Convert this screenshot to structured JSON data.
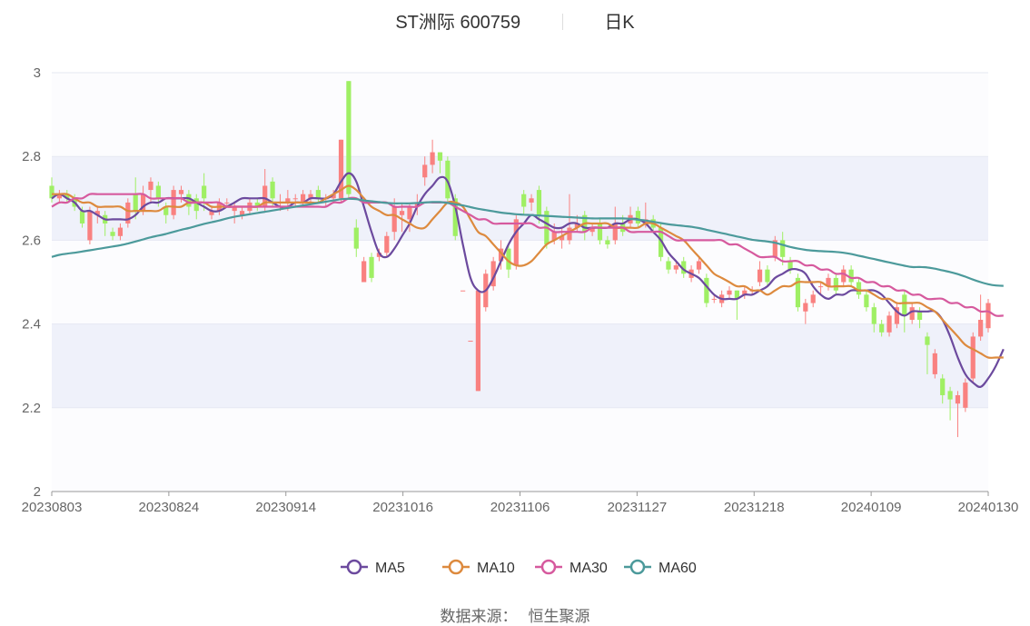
{
  "header": {
    "stock": "ST洲际 600759",
    "period": "日K"
  },
  "source": {
    "label": "数据来源：",
    "value": "恒生聚源"
  },
  "chart_data": {
    "type": "candlestick",
    "ylim": [
      2,
      3
    ],
    "y_ticks": [
      "2",
      "2.2",
      "2.4",
      "2.6",
      "2.8",
      "3"
    ],
    "x_ticks": [
      "20230803",
      "20230824",
      "20230914",
      "20231016",
      "20231106",
      "20231127",
      "20231218",
      "20240109",
      "20240130"
    ],
    "colors": {
      "up": "#f98180",
      "down": "#9fef64",
      "band": "#eff1fa",
      "grid": "#e6e8f2",
      "axis": "#999999"
    },
    "candles": [
      [
        2.73,
        2.7,
        2.75,
        2.69
      ],
      [
        2.7,
        2.71,
        2.72,
        2.69
      ],
      [
        2.71,
        2.7,
        2.72,
        2.69
      ],
      [
        2.7,
        2.68,
        2.71,
        2.67
      ],
      [
        2.67,
        2.64,
        2.68,
        2.63
      ],
      [
        2.6,
        2.67,
        2.68,
        2.59
      ],
      [
        2.66,
        2.67,
        2.68,
        2.64
      ],
      [
        2.66,
        2.64,
        2.67,
        2.61
      ],
      [
        2.62,
        2.61,
        2.63,
        2.6
      ],
      [
        2.61,
        2.63,
        2.64,
        2.6
      ],
      [
        2.64,
        2.69,
        2.7,
        2.63
      ],
      [
        2.71,
        2.67,
        2.75,
        2.65
      ],
      [
        2.67,
        2.71,
        2.73,
        2.66
      ],
      [
        2.72,
        2.74,
        2.75,
        2.69
      ],
      [
        2.73,
        2.7,
        2.74,
        2.68
      ],
      [
        2.68,
        2.66,
        2.69,
        2.64
      ],
      [
        2.66,
        2.72,
        2.73,
        2.65
      ],
      [
        2.71,
        2.72,
        2.73,
        2.69
      ],
      [
        2.71,
        2.68,
        2.72,
        2.66
      ],
      [
        2.7,
        2.67,
        2.71,
        2.65
      ],
      [
        2.73,
        2.7,
        2.76,
        2.67
      ],
      [
        2.66,
        2.67,
        2.68,
        2.65
      ],
      [
        2.67,
        2.69,
        2.7,
        2.66
      ],
      [
        2.69,
        2.69,
        2.7,
        2.68
      ],
      [
        2.67,
        2.68,
        2.69,
        2.64
      ],
      [
        2.66,
        2.67,
        2.68,
        2.65
      ],
      [
        2.67,
        2.69,
        2.7,
        2.66
      ],
      [
        2.69,
        2.68,
        2.7,
        2.67
      ],
      [
        2.68,
        2.73,
        2.77,
        2.67
      ],
      [
        2.74,
        2.7,
        2.75,
        2.68
      ],
      [
        2.69,
        2.69,
        2.71,
        2.67
      ],
      [
        2.69,
        2.7,
        2.72,
        2.67
      ],
      [
        2.7,
        2.7,
        2.71,
        2.68
      ],
      [
        2.69,
        2.71,
        2.72,
        2.68
      ],
      [
        2.7,
        2.71,
        2.72,
        2.69
      ],
      [
        2.72,
        2.7,
        2.73,
        2.69
      ],
      [
        2.7,
        2.7,
        2.71,
        2.68
      ],
      [
        2.7,
        2.71,
        2.72,
        2.69
      ],
      [
        2.7,
        2.84,
        2.84,
        2.69
      ],
      [
        2.98,
        2.71,
        2.98,
        2.7
      ],
      [
        2.63,
        2.58,
        2.65,
        2.56
      ],
      [
        2.5,
        2.55,
        2.56,
        2.5
      ],
      [
        2.56,
        2.51,
        2.57,
        2.5
      ],
      [
        2.56,
        2.57,
        2.58,
        2.55
      ],
      [
        2.57,
        2.61,
        2.62,
        2.56
      ],
      [
        2.62,
        2.68,
        2.7,
        2.6
      ],
      [
        2.66,
        2.67,
        2.69,
        2.62
      ],
      [
        2.65,
        2.68,
        2.69,
        2.62
      ],
      [
        2.68,
        2.69,
        2.71,
        2.66
      ],
      [
        2.75,
        2.78,
        2.8,
        2.73
      ],
      [
        2.78,
        2.81,
        2.84,
        2.76
      ],
      [
        2.81,
        2.79,
        2.81,
        2.76
      ],
      [
        2.79,
        2.7,
        2.8,
        2.69
      ],
      [
        2.7,
        2.61,
        2.71,
        2.6
      ],
      [
        2.48,
        2.48,
        2.48,
        2.48
      ],
      [
        2.36,
        2.36,
        2.36,
        2.36
      ],
      [
        2.24,
        2.48,
        2.48,
        2.24
      ],
      [
        2.44,
        2.52,
        2.53,
        2.43
      ],
      [
        2.49,
        2.55,
        2.56,
        2.48
      ],
      [
        2.55,
        2.58,
        2.6,
        2.53
      ],
      [
        2.58,
        2.53,
        2.59,
        2.51
      ],
      [
        2.54,
        2.65,
        2.66,
        2.53
      ],
      [
        2.71,
        2.68,
        2.72,
        2.66
      ],
      [
        2.69,
        2.7,
        2.71,
        2.67
      ],
      [
        2.72,
        2.66,
        2.73,
        2.64
      ],
      [
        2.67,
        2.59,
        2.68,
        2.58
      ],
      [
        2.6,
        2.62,
        2.64,
        2.59
      ],
      [
        2.6,
        2.61,
        2.63,
        2.58
      ],
      [
        2.6,
        2.63,
        2.71,
        2.59
      ],
      [
        2.63,
        2.64,
        2.66,
        2.62
      ],
      [
        2.66,
        2.62,
        2.67,
        2.6
      ],
      [
        2.62,
        2.63,
        2.64,
        2.61
      ],
      [
        2.64,
        2.6,
        2.65,
        2.59
      ],
      [
        2.6,
        2.59,
        2.61,
        2.58
      ],
      [
        2.6,
        2.64,
        2.68,
        2.59
      ],
      [
        2.64,
        2.62,
        2.66,
        2.61
      ],
      [
        2.64,
        2.66,
        2.68,
        2.63
      ],
      [
        2.67,
        2.64,
        2.68,
        2.63
      ],
      [
        2.64,
        2.65,
        2.69,
        2.63
      ],
      [
        2.65,
        2.63,
        2.66,
        2.62
      ],
      [
        2.63,
        2.56,
        2.64,
        2.55
      ],
      [
        2.55,
        2.53,
        2.56,
        2.52
      ],
      [
        2.53,
        2.54,
        2.55,
        2.52
      ],
      [
        2.55,
        2.52,
        2.56,
        2.51
      ],
      [
        2.51,
        2.53,
        2.54,
        2.5
      ],
      [
        2.53,
        2.55,
        2.56,
        2.52
      ],
      [
        2.51,
        2.45,
        2.52,
        2.44
      ],
      [
        2.46,
        2.46,
        2.47,
        2.45
      ],
      [
        2.45,
        2.47,
        2.48,
        2.44
      ],
      [
        2.47,
        2.48,
        2.49,
        2.46
      ],
      [
        2.48,
        2.46,
        2.48,
        2.41
      ],
      [
        2.47,
        2.48,
        2.49,
        2.46
      ],
      [
        2.48,
        2.48,
        2.49,
        2.47
      ],
      [
        2.5,
        2.53,
        2.55,
        2.49
      ],
      [
        2.53,
        2.5,
        2.54,
        2.49
      ],
      [
        2.56,
        2.6,
        2.61,
        2.55
      ],
      [
        2.6,
        2.56,
        2.62,
        2.54
      ],
      [
        2.55,
        2.53,
        2.56,
        2.52
      ],
      [
        2.51,
        2.44,
        2.52,
        2.43
      ],
      [
        2.43,
        2.45,
        2.46,
        2.4
      ],
      [
        2.45,
        2.47,
        2.48,
        2.44
      ],
      [
        2.49,
        2.49,
        2.5,
        2.47
      ],
      [
        2.49,
        2.51,
        2.52,
        2.48
      ],
      [
        2.51,
        2.48,
        2.52,
        2.47
      ],
      [
        2.5,
        2.53,
        2.54,
        2.49
      ],
      [
        2.53,
        2.5,
        2.54,
        2.49
      ],
      [
        2.5,
        2.47,
        2.51,
        2.46
      ],
      [
        2.47,
        2.44,
        2.48,
        2.43
      ],
      [
        2.44,
        2.4,
        2.45,
        2.38
      ],
      [
        2.4,
        2.38,
        2.41,
        2.37
      ],
      [
        2.38,
        2.42,
        2.43,
        2.37
      ],
      [
        2.4,
        2.44,
        2.45,
        2.39
      ],
      [
        2.47,
        2.42,
        2.48,
        2.38
      ],
      [
        2.41,
        2.44,
        2.45,
        2.4
      ],
      [
        2.43,
        2.41,
        2.44,
        2.39
      ],
      [
        2.37,
        2.35,
        2.38,
        2.28
      ],
      [
        2.28,
        2.33,
        2.34,
        2.27
      ],
      [
        2.27,
        2.23,
        2.28,
        2.21
      ],
      [
        2.24,
        2.22,
        2.25,
        2.17
      ],
      [
        2.21,
        2.23,
        2.24,
        2.13
      ],
      [
        2.2,
        2.26,
        2.27,
        2.19
      ],
      [
        2.27,
        2.37,
        2.38,
        2.26
      ],
      [
        2.37,
        2.41,
        2.47,
        2.36
      ],
      [
        2.39,
        2.45,
        2.46,
        2.38
      ]
    ],
    "series": [
      {
        "name": "MA5",
        "color": "#6c4a9e",
        "values": [
          2.7,
          2.71,
          2.7,
          2.69,
          2.67,
          2.67,
          2.66,
          2.65,
          2.65,
          2.65,
          2.65,
          2.66,
          2.68,
          2.69,
          2.69,
          2.7,
          2.7,
          2.7,
          2.7,
          2.69,
          2.68,
          2.67,
          2.67,
          2.68,
          2.69,
          2.7,
          2.7,
          2.7,
          2.7,
          2.69,
          2.68,
          2.68,
          2.69,
          2.69,
          2.7,
          2.7,
          2.7,
          2.71,
          2.74,
          2.76,
          2.74,
          2.68,
          2.62,
          2.57,
          2.56,
          2.58,
          2.61,
          2.64,
          2.68,
          2.71,
          2.73,
          2.75,
          2.74,
          2.68,
          2.59,
          2.51,
          2.48,
          2.48,
          2.51,
          2.55,
          2.59,
          2.62,
          2.64,
          2.66,
          2.65,
          2.64,
          2.63,
          2.63,
          2.64,
          2.64,
          2.63,
          2.63,
          2.63,
          2.63,
          2.64,
          2.64,
          2.65,
          2.65,
          2.64,
          2.62,
          2.6,
          2.57,
          2.55,
          2.53,
          2.52,
          2.51,
          2.49,
          2.47,
          2.46,
          2.46,
          2.46,
          2.47,
          2.47,
          2.48,
          2.49,
          2.51,
          2.52,
          2.53,
          2.53,
          2.52,
          2.49,
          2.47,
          2.46,
          2.47,
          2.47,
          2.48,
          2.48,
          2.48,
          2.48,
          2.47,
          2.45,
          2.43,
          2.42,
          2.43,
          2.43,
          2.43,
          2.43,
          2.41,
          2.37,
          2.32,
          2.28,
          2.26,
          2.25,
          2.27,
          2.3,
          2.34
        ]
      },
      {
        "name": "MA10",
        "color": "#dd8a3e",
        "values": [
          2.71,
          2.71,
          2.71,
          2.7,
          2.69,
          2.69,
          2.68,
          2.68,
          2.68,
          2.68,
          2.67,
          2.67,
          2.67,
          2.67,
          2.67,
          2.68,
          2.68,
          2.68,
          2.69,
          2.69,
          2.69,
          2.68,
          2.68,
          2.68,
          2.68,
          2.68,
          2.68,
          2.68,
          2.69,
          2.69,
          2.69,
          2.69,
          2.69,
          2.69,
          2.69,
          2.69,
          2.7,
          2.71,
          2.72,
          2.73,
          2.72,
          2.7,
          2.68,
          2.67,
          2.66,
          2.66,
          2.65,
          2.64,
          2.63,
          2.63,
          2.65,
          2.67,
          2.69,
          2.69,
          2.68,
          2.65,
          2.62,
          2.61,
          2.59,
          2.57,
          2.55,
          2.54,
          2.54,
          2.55,
          2.57,
          2.59,
          2.6,
          2.61,
          2.62,
          2.63,
          2.64,
          2.64,
          2.64,
          2.64,
          2.63,
          2.63,
          2.63,
          2.63,
          2.64,
          2.64,
          2.63,
          2.62,
          2.61,
          2.6,
          2.58,
          2.56,
          2.54,
          2.52,
          2.51,
          2.5,
          2.49,
          2.49,
          2.48,
          2.48,
          2.47,
          2.48,
          2.49,
          2.49,
          2.5,
          2.5,
          2.5,
          2.5,
          2.49,
          2.49,
          2.49,
          2.49,
          2.48,
          2.48,
          2.47,
          2.46,
          2.46,
          2.45,
          2.45,
          2.45,
          2.45,
          2.44,
          2.43,
          2.41,
          2.39,
          2.37,
          2.35,
          2.34,
          2.33,
          2.32,
          2.32,
          2.32
        ]
      },
      {
        "name": "MA30",
        "color": "#d65a9e",
        "values": [
          2.68,
          2.69,
          2.69,
          2.7,
          2.7,
          2.71,
          2.71,
          2.71,
          2.71,
          2.71,
          2.71,
          2.71,
          2.71,
          2.7,
          2.7,
          2.7,
          2.7,
          2.7,
          2.69,
          2.69,
          2.69,
          2.69,
          2.69,
          2.68,
          2.68,
          2.68,
          2.68,
          2.68,
          2.68,
          2.68,
          2.68,
          2.68,
          2.68,
          2.68,
          2.68,
          2.68,
          2.68,
          2.69,
          2.69,
          2.7,
          2.7,
          2.69,
          2.69,
          2.69,
          2.69,
          2.68,
          2.68,
          2.68,
          2.68,
          2.69,
          2.69,
          2.69,
          2.69,
          2.68,
          2.67,
          2.66,
          2.65,
          2.65,
          2.64,
          2.64,
          2.64,
          2.64,
          2.64,
          2.64,
          2.63,
          2.63,
          2.62,
          2.62,
          2.62,
          2.62,
          2.62,
          2.63,
          2.63,
          2.63,
          2.63,
          2.63,
          2.62,
          2.62,
          2.62,
          2.62,
          2.62,
          2.61,
          2.6,
          2.6,
          2.6,
          2.6,
          2.6,
          2.6,
          2.6,
          2.59,
          2.59,
          2.58,
          2.57,
          2.56,
          2.56,
          2.56,
          2.55,
          2.55,
          2.55,
          2.54,
          2.54,
          2.53,
          2.53,
          2.52,
          2.52,
          2.51,
          2.51,
          2.5,
          2.5,
          2.49,
          2.49,
          2.48,
          2.48,
          2.47,
          2.47,
          2.46,
          2.46,
          2.46,
          2.45,
          2.45,
          2.44,
          2.44,
          2.43,
          2.43,
          2.42,
          2.42
        ]
      },
      {
        "name": "MA60",
        "color": "#4c9a9b",
        "values": [
          2.56,
          2.565,
          2.568,
          2.57,
          2.573,
          2.576,
          2.579,
          2.582,
          2.585,
          2.588,
          2.592,
          2.597,
          2.602,
          2.607,
          2.611,
          2.615,
          2.62,
          2.625,
          2.629,
          2.634,
          2.639,
          2.643,
          2.647,
          2.652,
          2.656,
          2.659,
          2.662,
          2.665,
          2.668,
          2.671,
          2.674,
          2.677,
          2.68,
          2.683,
          2.686,
          2.689,
          2.692,
          2.695,
          2.698,
          2.699,
          2.698,
          2.695,
          2.693,
          2.691,
          2.689,
          2.688,
          2.688,
          2.688,
          2.689,
          2.69,
          2.691,
          2.691,
          2.689,
          2.686,
          2.683,
          2.679,
          2.675,
          2.672,
          2.669,
          2.666,
          2.664,
          2.662,
          2.661,
          2.66,
          2.659,
          2.658,
          2.657,
          2.656,
          2.655,
          2.654,
          2.653,
          2.652,
          2.652,
          2.652,
          2.652,
          2.652,
          2.651,
          2.649,
          2.647,
          2.644,
          2.641,
          2.638,
          2.636,
          2.634,
          2.632,
          2.629,
          2.625,
          2.621,
          2.617,
          2.613,
          2.609,
          2.605,
          2.601,
          2.599,
          2.597,
          2.594,
          2.589,
          2.584,
          2.58,
          2.577,
          2.575,
          2.574,
          2.573,
          2.572,
          2.57,
          2.567,
          2.563,
          2.559,
          2.555,
          2.551,
          2.547,
          2.543,
          2.539,
          2.536,
          2.536,
          2.535,
          2.532,
          2.528,
          2.524,
          2.519,
          2.513,
          2.506,
          2.5,
          2.495,
          2.492,
          2.491
        ]
      }
    ]
  }
}
